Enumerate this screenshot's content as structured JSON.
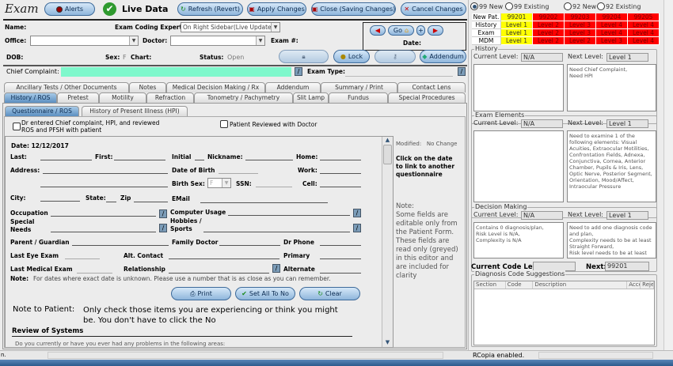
{
  "header": {
    "title": "Exam",
    "alerts": "Alerts",
    "live_data": "Live Data",
    "refresh": "Refresh (Revert)",
    "apply": "Apply Changes",
    "close": "Close (Saving Changes)",
    "cancel": "Cancel Changes"
  },
  "patient": {
    "name_label": "Name:",
    "coding_expert_label": "Exam Coding Expert:",
    "coding_expert_value": "On Right Sidebar(Live Update)",
    "office_label": "Office:",
    "doctor_label": "Doctor:",
    "exam_no_label": "Exam #:",
    "dob_label": "DOB:",
    "sex_label": "Sex:",
    "sex_value": "F",
    "chart_label": "Chart:",
    "status_label": "Status:",
    "status_value": "Open",
    "go": "Go",
    "date_label": "Date:",
    "lock": "Lock",
    "addendum": "Addendum",
    "chief_complaint_label": "Chief Complaint:",
    "exam_type_label": "Exam Type:"
  },
  "colors": {
    "chief_complaint_bg": "#7ff8cc",
    "level_met": "#ffff00",
    "level_unmet": "#ff0000",
    "accent": "#5b8fc0"
  },
  "tabs_row1": [
    "Ancillary Tests / Other Documents",
    "Notes",
    "Medical Decision Making / Rx",
    "Addendum",
    "Summary / Print",
    "Contact Lens"
  ],
  "tabs_row2": [
    "History / ROS",
    "Pretest",
    "Motility",
    "Refraction",
    "Tonometry / Pachymetry",
    "Slit Lamp",
    "Fundus",
    "Special Procedures"
  ],
  "subtabs": [
    "Questionnaire / ROS",
    "History of Present Illness (HPI)"
  ],
  "checks": {
    "dr_entered": "Dr entered Chief complaint, HPI, and reviewed ROS and PFSH with patient",
    "patient_reviewed": "Patient Reviewed with Doctor"
  },
  "form": {
    "date": "Date: 12/12/2017",
    "last": "Last:",
    "first": "First:",
    "initial": "Initial",
    "nickname": "Nickname:",
    "home": "Home:",
    "address": "Address:",
    "dob": "Date of Birth",
    "work": "Work:",
    "birth_sex": "Birth Sex:",
    "birth_sex_value": "F",
    "ssn": "SSN:",
    "cell": "Cell:",
    "city": "City:",
    "state": "State:",
    "zip": "Zip",
    "email": "EMail",
    "occupation": "Occupation",
    "computer_usage": "Computer Usage",
    "special_needs": "Special Needs",
    "hobbies": "Hobbies / Sports",
    "parent": "Parent / Guardian",
    "family_doctor": "Family Doctor",
    "dr_phone": "Dr Phone",
    "last_eye": "Last Eye Exam",
    "alt_contact": "Alt. Contact",
    "primary": "Primary",
    "last_medical": "Last Medical Exam",
    "relationship": "Relationship",
    "alternate": "Alternate",
    "note_label": "Note:",
    "note_text": "For dates where exact date is unknown.  Please use a number that is as close as you can remember.",
    "print": "Print",
    "set_all_no": "Set All To No",
    "clear": "Clear",
    "note_to_patient_label": "Note to Patient:",
    "note_to_patient": "Only check those items you are experiencing or think you might be.  You don't have to click the No",
    "ros_title": "Review of Systems",
    "ros_question": "Do you currently or have you ever had any problems in the following areas:"
  },
  "side_note": {
    "modified": "Modified:   No Change",
    "click": "Click on the date to link to another questionnaire",
    "note": "Note:",
    "text": "Some fields are editable only from the Patient Form. These fields are read only (greyed) in this editor and are included for clarity"
  },
  "coding": {
    "radios": [
      {
        "label": "99 New",
        "checked": true
      },
      {
        "label": "99 Existing",
        "checked": false
      },
      {
        "label": "92 New",
        "checked": false
      },
      {
        "label": "92 Existing",
        "checked": false
      }
    ],
    "rows": [
      {
        "label": "New Pat.",
        "cells": [
          "99201",
          "99202",
          "99203",
          "99204",
          "99205"
        ]
      },
      {
        "label": "History",
        "cells": [
          "Level 1",
          "Level 2",
          "Level 3",
          "Level 4",
          "Level 4"
        ]
      },
      {
        "label": "Exam",
        "cells": [
          "Level 1",
          "Level 2",
          "Level 3",
          "Level 4",
          "Level 4"
        ]
      },
      {
        "label": "MDM",
        "cells": [
          "Level 1",
          "Level 2",
          "Level 2",
          "Level 3",
          "Level 4"
        ]
      }
    ],
    "history": {
      "title": "History",
      "current_label": "Current Level:",
      "current": "N/A",
      "next_label": "Next Level:",
      "next": "Level 1",
      "left": "",
      "right": "Need Chief Complaint,\nNeed HPI"
    },
    "exam": {
      "title": "Exam Elements",
      "current_label": "Current Level:",
      "current": "N/A",
      "next_label": "Next Level:",
      "next": "Level 1",
      "left": "",
      "right": "Need to examine 1 of the following elements: Visual Acuities, Extraocular Motilities, Confrontation Fields, Adnexa, Conjunctiva, Cornea, Anterior Chamber, Pupils & Iris, Lens, Optic Nerve, Posterior Segment, Orientation, Mood/Affect, Intraocular Pressure"
    },
    "mdm": {
      "title": "Decision Making",
      "current_label": "Current Level:",
      "current": "N/A",
      "next_label": "Next Level:",
      "next": "Level 1",
      "left": "Contains 0 diagnosis/plan,\nRisk Level is N/A,\nComplexity is N/A",
      "right": "Need to add one diagnosis code and plan,\nComplexity needs to be at least Straight Forward,\nRisk level needs to be at least"
    },
    "current_code_label": "Current Code Level:",
    "current_code": "",
    "next_label": "Next:",
    "next_code": "99201",
    "diag_title": "Diagnosis Code Suggestions",
    "diag_cols": [
      "Section",
      "Code",
      "Description",
      "Accept",
      "Reject"
    ]
  },
  "status": {
    "left": "n.",
    "rcopia": "RCopia enabled."
  }
}
